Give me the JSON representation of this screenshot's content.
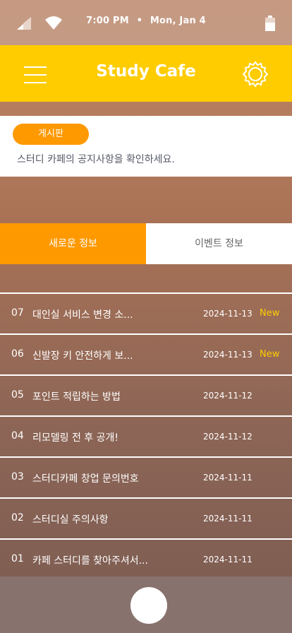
{
  "status_bar": {
    "time": "7:00 PM",
    "separator": "•",
    "date": "Mon, Jan 4",
    "icons": [
      "signal-icon",
      "wifi-icon",
      "battery-icon"
    ]
  },
  "app_bar": {
    "title": "Study Cafe",
    "accent_color": "#ffcc00",
    "icons": [
      "menu-icon",
      "gear-icon"
    ]
  },
  "notice": {
    "badge": "게시판",
    "description": "스터디 카페의 공지사항을 확인하세요.",
    "badge_color": "#ff9900"
  },
  "tabs": [
    {
      "label": "새로운 정보",
      "active": true
    },
    {
      "label": "이벤트 정보",
      "active": false
    }
  ],
  "posts": [
    {
      "num": "07",
      "subject": "대인실 서비스 변경 소...",
      "date": "2024-11-13",
      "badge": "New"
    },
    {
      "num": "06",
      "subject": "신발장 키 안전하게 보...",
      "date": "2024-11-13",
      "badge": "New"
    },
    {
      "num": "05",
      "subject": "포인트 적립하는 방법",
      "date": "2024-11-12",
      "badge": ""
    },
    {
      "num": "04",
      "subject": "리모델링 전 후 공개!",
      "date": "2024-11-12",
      "badge": ""
    },
    {
      "num": "03",
      "subject": "스터디카페 창업 문의번호",
      "date": "2024-11-11",
      "badge": ""
    },
    {
      "num": "02",
      "subject": "스터디실 주의사항",
      "date": "2024-11-11",
      "badge": ""
    },
    {
      "num": "01",
      "subject": "카페 스터디를 찾아주셔서...",
      "date": "2024-11-11",
      "badge": ""
    }
  ],
  "new_badge_color": "#ffcc00"
}
